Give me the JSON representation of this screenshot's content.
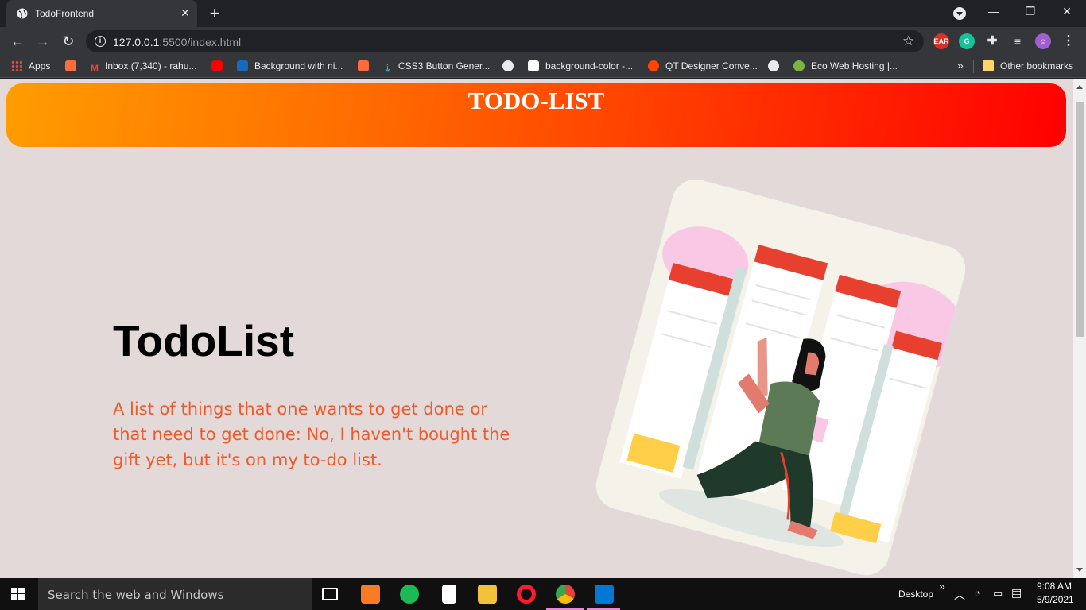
{
  "browser": {
    "tab_title": "TodoFrontend",
    "tab_close": "✕",
    "new_tab": "+",
    "url_host": "127.0.0.1",
    "url_rest": ":5500/index.html",
    "window_controls": {
      "minimize": "—",
      "restore": "❐",
      "close": "✕"
    }
  },
  "bookmarks": [
    {
      "label": "Apps",
      "icon": "apps-grid-icon"
    },
    {
      "label": "",
      "icon": "ublock-icon",
      "color": "#ff6b3d"
    },
    {
      "label": "Inbox (7,340) - rahu...",
      "icon": "gmail-icon",
      "color": "#ea4335"
    },
    {
      "label": "",
      "icon": "youtube-icon",
      "color": "#ff0000"
    },
    {
      "label": "Background with ni...",
      "icon": "vuetify-icon",
      "color": "#1867c0"
    },
    {
      "label": "",
      "icon": "ublock-icon",
      "color": "#ff6b3d"
    },
    {
      "label": "CSS3 Button Gener...",
      "icon": "arrow-down-icon",
      "color": "#1fc7c7"
    },
    {
      "label": "background-color -...",
      "icon": "mdn-icon",
      "color": "#ffffff"
    },
    {
      "label": "QT Designer Conve...",
      "icon": "reddit-icon",
      "color": "#ff4500"
    },
    {
      "label": "Eco Web Hosting |...",
      "icon": "globe-icon",
      "color": "#7cb342"
    }
  ],
  "bookmarks_overflow": "»",
  "other_bookmarks": "Other bookmarks",
  "page": {
    "banner_title": "TODO-LIST",
    "hero_title": "TodoList",
    "hero_description": "A list of things that one wants to get done or that need to get done: No, I haven't bought the gift yet, but it's on my to-do list."
  },
  "taskbar": {
    "search_placeholder": "Search the web and Windows",
    "desktop_label": "Desktop",
    "overflow": "»",
    "time": "9:08 AM",
    "date": "5/9/2021"
  },
  "colors": {
    "page_bg": "#e3d9d9",
    "banner_start": "#ff9d00",
    "banner_end": "#ff0000",
    "hero_desc": "#f05a28"
  }
}
